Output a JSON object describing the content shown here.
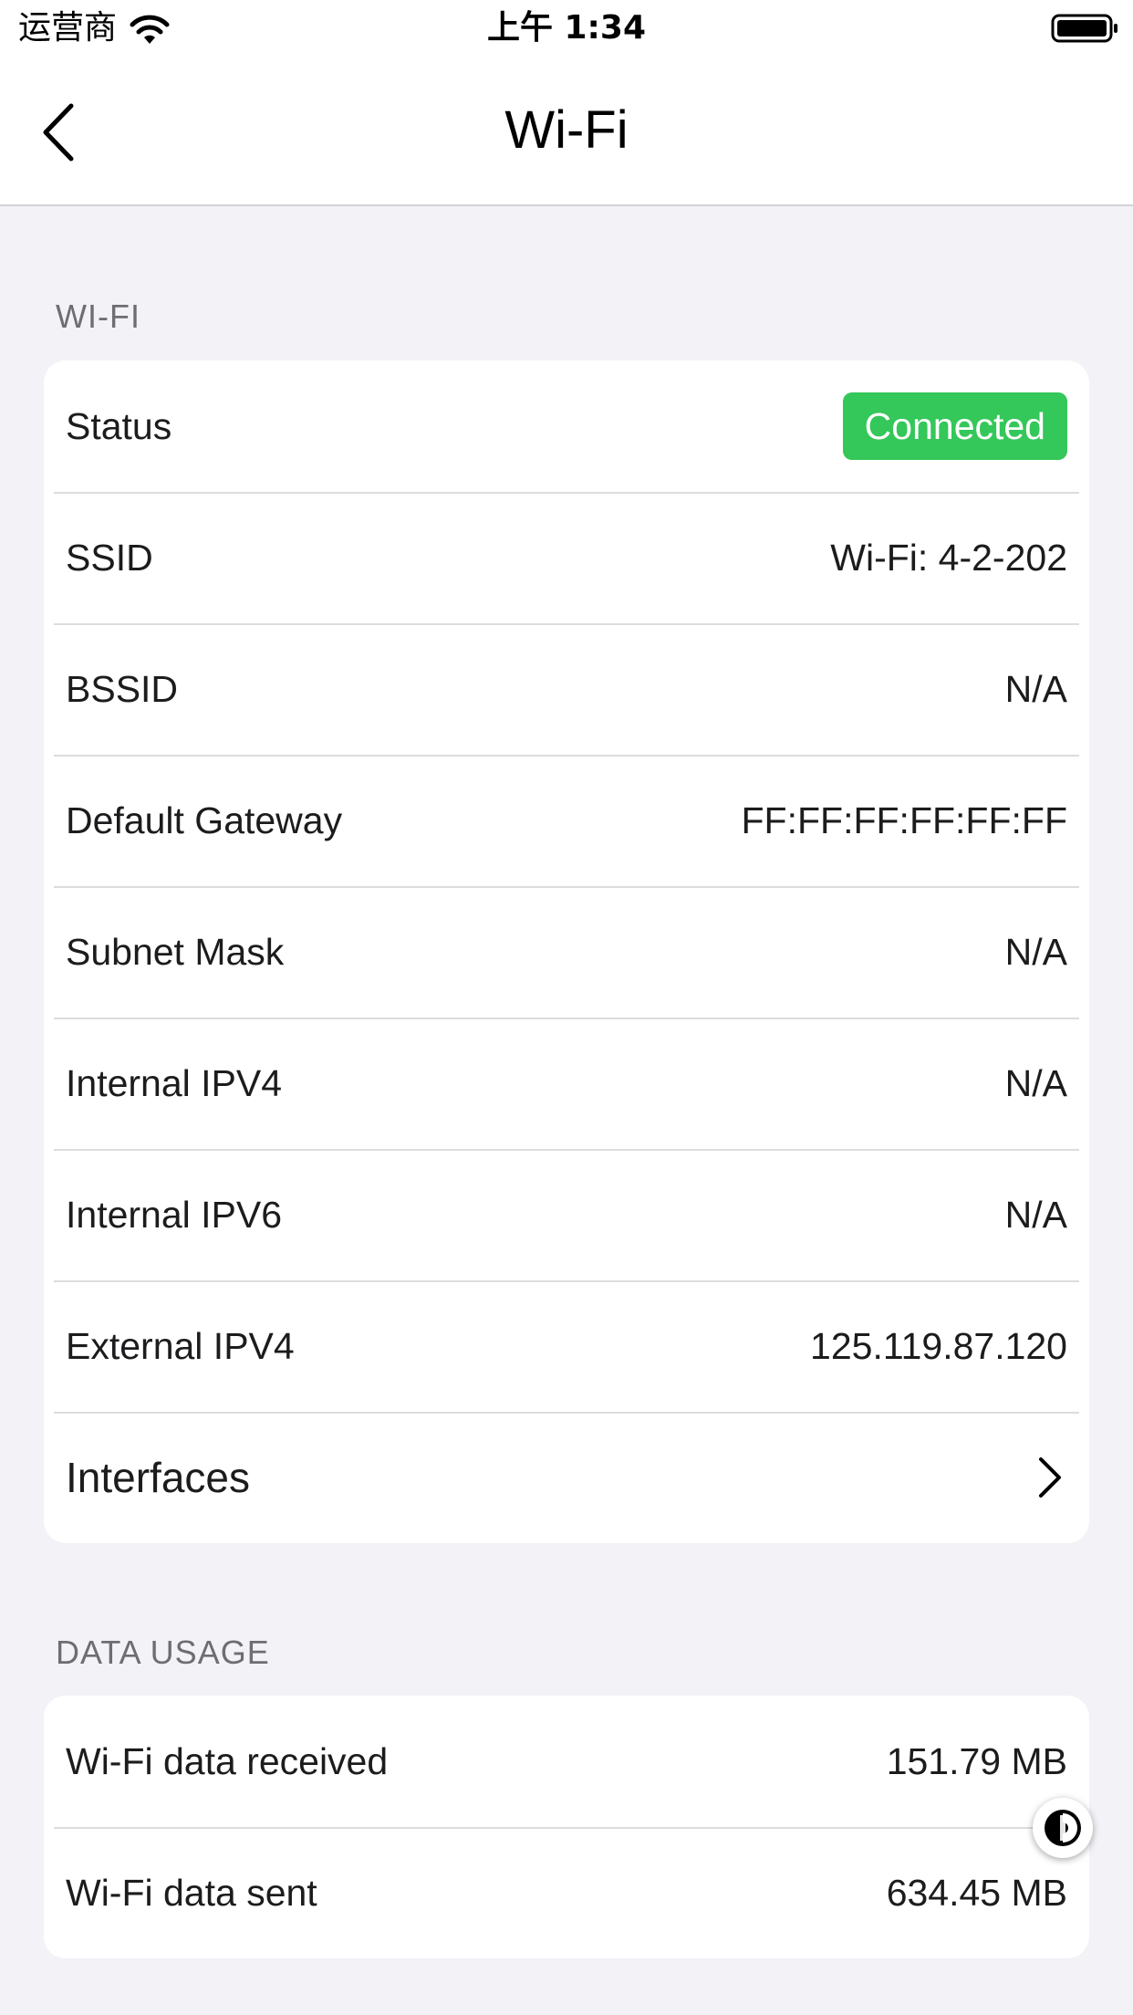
{
  "status_bar": {
    "carrier": "运营商",
    "time": "上午 1:34",
    "wifi_icon": "wifi-signal-icon",
    "battery_icon": "battery-full-icon"
  },
  "nav": {
    "title": "Wi-Fi",
    "back_icon": "chevron-left-icon"
  },
  "wifi_section": {
    "header": "WI-FI",
    "status": {
      "label": "Status",
      "value": "Connected",
      "color": "#34c759"
    },
    "rows": [
      {
        "label": "SSID",
        "value": "Wi-Fi: 4-2-202"
      },
      {
        "label": "BSSID",
        "value": "N/A"
      },
      {
        "label": "Default Gateway",
        "value": "FF:FF:FF:FF:FF:FF"
      },
      {
        "label": "Subnet Mask",
        "value": "N/A"
      },
      {
        "label": "Internal IPV4",
        "value": "N/A"
      },
      {
        "label": "Internal IPV6",
        "value": "N/A"
      },
      {
        "label": "External IPV4",
        "value": "125.119.87.120"
      }
    ],
    "interfaces": {
      "label": "Interfaces",
      "icon": "chevron-right-icon"
    }
  },
  "data_usage_section": {
    "header": "DATA USAGE",
    "rows": [
      {
        "label": "Wi-Fi data received",
        "value": "151.79 MB"
      },
      {
        "label": "Wi-Fi data sent",
        "value": "634.45 MB"
      }
    ]
  },
  "floating_button": {
    "icon": "assistive-touch-icon"
  }
}
